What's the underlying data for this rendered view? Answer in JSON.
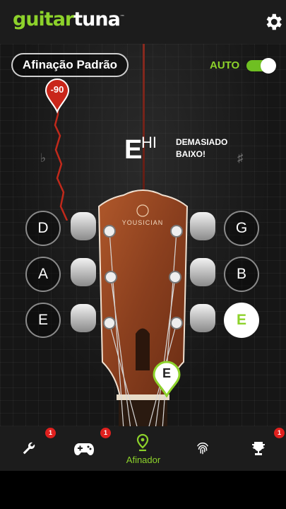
{
  "app": {
    "logo_text": "guitartuna",
    "logo_accent": "#8dd22b"
  },
  "header": {
    "settings_icon": "gear-icon"
  },
  "tuner": {
    "tuning_name": "Afinação Padrão",
    "auto_label": "AUTO",
    "auto_enabled": true,
    "cents_offset": "-90",
    "note": "E",
    "note_superscript": "HI",
    "status_line1": "DEMASIADO",
    "status_line2": "BAIXO!",
    "flat_symbol": "♭",
    "sharp_symbol": "♯",
    "brand": "YOUSICIAN",
    "current_string_label": "E"
  },
  "pegs": {
    "left": [
      "D",
      "A",
      "E"
    ],
    "right": [
      "G",
      "B",
      "E"
    ],
    "active": "right-3"
  },
  "nav": {
    "items": [
      {
        "icon": "wrench-icon",
        "badge": "1"
      },
      {
        "icon": "gamepad-icon",
        "badge": "1"
      },
      {
        "icon": "tuner-icon",
        "label": "Afinador",
        "active": true
      },
      {
        "icon": "fingerprint-icon"
      },
      {
        "icon": "trophy-icon",
        "badge": "1"
      }
    ]
  },
  "colors": {
    "accent": "#8dd22b",
    "needle": "#c0291b",
    "badge": "#e0201e",
    "wood": "#8a3f1e"
  }
}
